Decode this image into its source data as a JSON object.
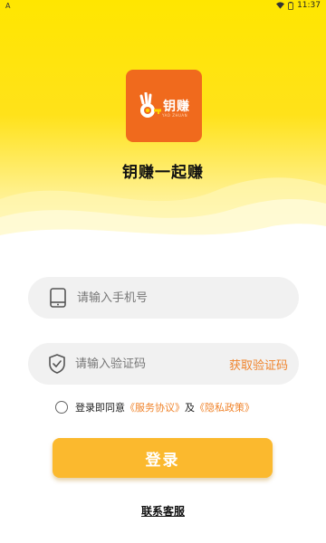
{
  "status_bar": {
    "left_label": "A",
    "time": "11:37"
  },
  "brand": {
    "logo_text": "钥赚",
    "logo_subtext": "YAO ZHUAN",
    "app_title": "钥赚一起赚",
    "accent_color": "#f06a1d"
  },
  "login_form": {
    "phone_placeholder": "请输入手机号",
    "code_placeholder": "请输入验证码",
    "get_code_label": "获取验证码",
    "agree_prefix": "登录即同意",
    "service_agreement": "《服务协议》",
    "agree_joiner": "及",
    "privacy_policy": "《隐私政策》",
    "login_label": "登录",
    "button_color": "#fbb92e",
    "link_color": "#f0842c"
  },
  "footer": {
    "contact_label": "联系客服"
  },
  "icons": [
    "wifi-icon",
    "battery-icon",
    "phone-icon",
    "shield-check-icon"
  ]
}
